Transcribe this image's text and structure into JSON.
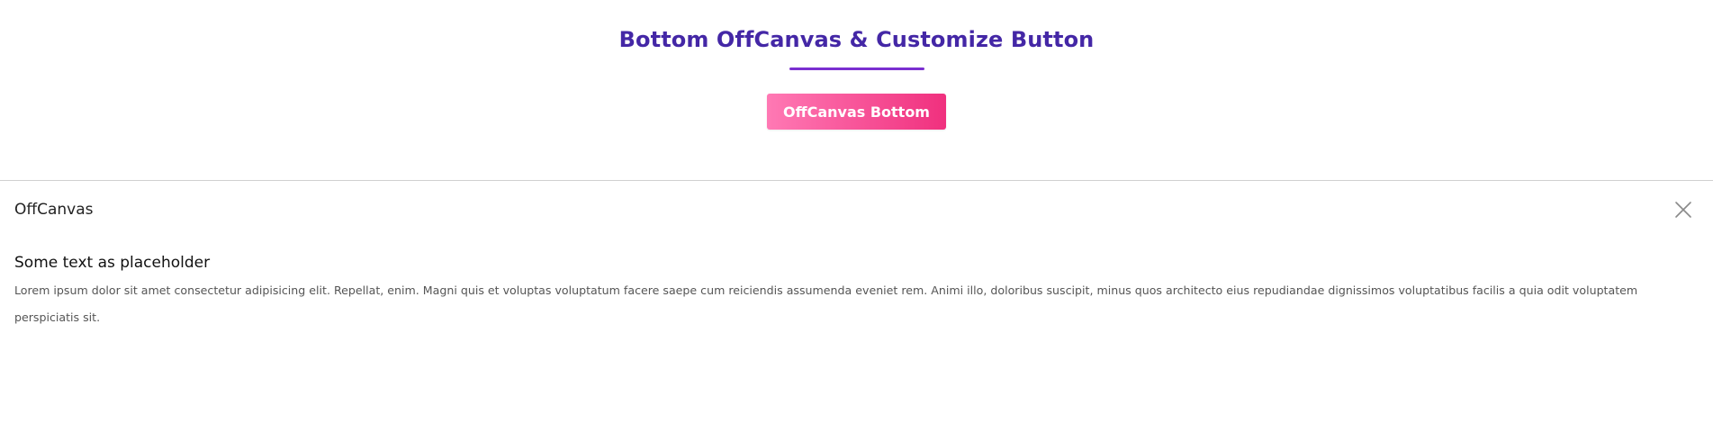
{
  "hero": {
    "title": "Bottom OffCanvas & Customize Button",
    "button_label": "OffCanvas Bottom"
  },
  "offcanvas": {
    "title": "OffCanvas",
    "close_icon": "close-icon",
    "heading": "Some text as placeholder",
    "body": "Lorem ipsum dolor sit amet consectetur adipisicing elit. Repellat, enim. Magni quis et voluptas voluptatum facere saepe cum reiciendis assumenda eveniet rem. Animi illo, doloribus suscipit, minus quos architecto eius repudiandae dignissimos voluptatibus facilis a quia odit voluptatem perspiciatis sit."
  },
  "colors": {
    "title": "#4427a6",
    "underline": "#7a2fd0",
    "button_gradient_start": "#ff79b4",
    "button_gradient_end": "#f0307e",
    "button_text": "#ffffff",
    "panel_border": "#d0d0d0"
  }
}
